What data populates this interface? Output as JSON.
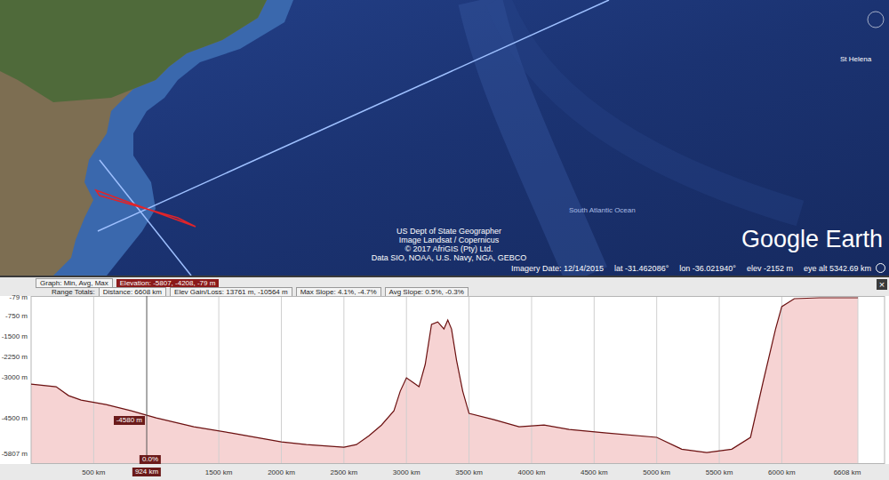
{
  "map": {
    "labels": [
      {
        "text": "St Helena"
      },
      {
        "text": "South Atlantic Ocean"
      }
    ],
    "attribution": [
      "US Dept of State Geographer",
      "Image Landsat / Copernicus",
      "© 2017 AfriGIS (Pty) Ltd.",
      "Data SIO, NOAA, U.S. Navy, NGA, GEBCO"
    ],
    "logo": "Google Earth",
    "status": [
      "Imagery Date: 12/14/2015",
      "lat -31.462086°",
      "lon -36.021940°",
      "elev -2152 m",
      "eye alt 5342.69 km"
    ]
  },
  "profile": {
    "graph_label": "Graph: Min, Avg, Max",
    "elevation": "Elevation: -5807, -4208, -79 m",
    "range_label": "Range Totals:",
    "totals": [
      "Distance: 6608 km",
      "Elev Gain/Loss: 13761 m, -10564 m",
      "Max Slope: 4.1%, -4.7%",
      "Avg Slope: 0.5%, -0.3%"
    ],
    "close": "×",
    "y_ticks": [
      {
        "label": "-79 m",
        "value": -79
      },
      {
        "label": "-750 m",
        "value": -750
      },
      {
        "label": "-1500 m",
        "value": -1500
      },
      {
        "label": "-2250 m",
        "value": -2250
      },
      {
        "label": "-3000 m",
        "value": -3000
      },
      {
        "label": "-4500 m",
        "value": -4500
      },
      {
        "label": "-5807 m",
        "value": -5807
      }
    ],
    "x_ticks": [
      {
        "label": "500 km",
        "value": 500
      },
      {
        "label": "1500 km",
        "value": 1500
      },
      {
        "label": "2000 km",
        "value": 2000
      },
      {
        "label": "2500 km",
        "value": 2500
      },
      {
        "label": "3000 km",
        "value": 3000
      },
      {
        "label": "3500 km",
        "value": 3500
      },
      {
        "label": "4000 km",
        "value": 4000
      },
      {
        "label": "4500 km",
        "value": 4500
      },
      {
        "label": "5000 km",
        "value": 5000
      },
      {
        "label": "5500 km",
        "value": 5500
      },
      {
        "label": "6000 km",
        "value": 6000
      },
      {
        "label": "6608 km",
        "value": 6608
      }
    ],
    "x_max": 6608,
    "series": {
      "distance_km": [
        0,
        200,
        300,
        400,
        600,
        800,
        924,
        1000,
        1300,
        1600,
        2000,
        2200,
        2500,
        2600,
        2700,
        2800,
        2900,
        2950,
        3000,
        3050,
        3100,
        3150,
        3200,
        3250,
        3300,
        3330,
        3360,
        3400,
        3450,
        3500,
        3700,
        3900,
        4100,
        4300,
        4600,
        5000,
        5200,
        5400,
        5600,
        5750,
        5850,
        5950,
        6000,
        6100,
        6300,
        6608
      ],
      "elevation_m": [
        -3239,
        -3336,
        -3662,
        -3825,
        -3990,
        -4215,
        -4380,
        -4477,
        -4800,
        -5030,
        -5356,
        -5455,
        -5550,
        -5455,
        -5130,
        -4740,
        -4215,
        -3500,
        -3010,
        -3170,
        -3336,
        -2520,
        -1056,
        -960,
        -1220,
        -893,
        -1220,
        -2360,
        -3500,
        -4313,
        -4540,
        -4800,
        -4740,
        -4900,
        -5030,
        -5190,
        -5620,
        -5750,
        -5620,
        -5190,
        -3170,
        -1220,
        -400,
        -110,
        -79,
        -79
      ]
    },
    "cursor": {
      "distance_km": 924,
      "elevation_m": -4580,
      "elevation_label": "-4580 m",
      "distance_label": "924 km",
      "slope_label": "0.0%"
    }
  }
}
